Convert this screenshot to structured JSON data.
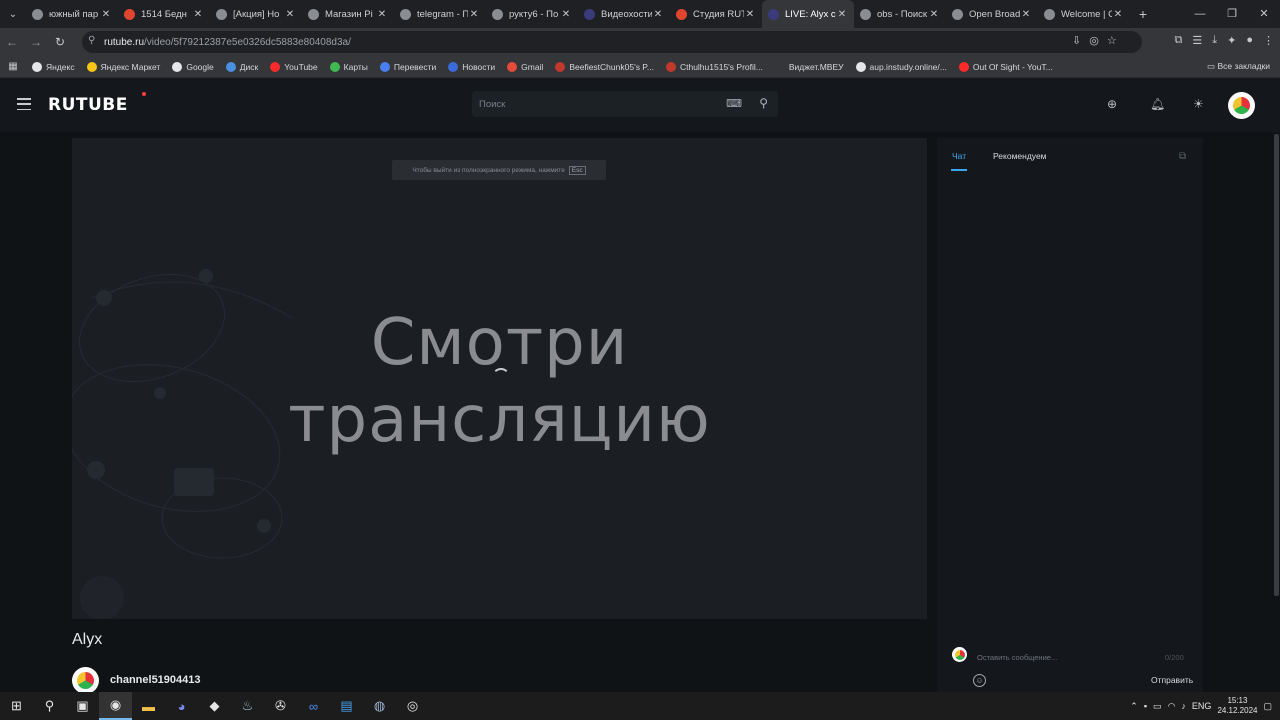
{
  "browser": {
    "tabs": [
      {
        "title": "южный пар",
        "color": "#8a8d91"
      },
      {
        "title": "1514 Бедн",
        "color": "#e0462f"
      },
      {
        "title": "[Акция] Но",
        "color": "#8a8d91"
      },
      {
        "title": "Магазин Pi",
        "color": "#8a8d91"
      },
      {
        "title": "telegram - П",
        "color": "#8a8d91"
      },
      {
        "title": "рукту6 - По",
        "color": "#8a8d91"
      },
      {
        "title": "Видеохости",
        "color": "#3b3a7a"
      },
      {
        "title": "Студия RUT",
        "color": "#e0462f"
      },
      {
        "title": "LIVE: Alyx c",
        "color": "#3b3a7a"
      },
      {
        "title": "obs - Поиск",
        "color": "#8a8d91"
      },
      {
        "title": "Open Broad",
        "color": "#8a8d91"
      },
      {
        "title": "Welcome | C",
        "color": "#8a8d91"
      }
    ],
    "active_tab_index": 8,
    "url_host": "rutube.ru",
    "url_path": "/video/5f79212387e5e0326dc5883e80408d3a/",
    "bookmarks": [
      {
        "label": "Яндекс",
        "color": "#e4e6e9"
      },
      {
        "label": "Яндекс Маркет",
        "color": "#f5c518"
      },
      {
        "label": "Google",
        "color": "#e4e6e9"
      },
      {
        "label": "Диск",
        "color": "#4a90e2"
      },
      {
        "label": "YouTube",
        "color": "#ff2a2a"
      },
      {
        "label": "Карты",
        "color": "#3fb950"
      },
      {
        "label": "Перевести",
        "color": "#4a7ff0"
      },
      {
        "label": "Новости",
        "color": "#3a6bd8"
      },
      {
        "label": "Gmail",
        "color": "#e44b3b"
      },
      {
        "label": "BeefiestChunk05's P...",
        "color": "#c0392b"
      },
      {
        "label": "Cthulhu1515's Profil...",
        "color": "#c0392b"
      },
      {
        "label": "Виджет.МВЕУ",
        "color": "#35363a"
      },
      {
        "label": "aup.instudy.online/...",
        "color": "#e4e6e9"
      },
      {
        "label": "Out Of Sight - YouT...",
        "color": "#ff2a2a"
      }
    ],
    "all_bookmarks": "Все закладки"
  },
  "header": {
    "logo": "RUTUBE",
    "search_placeholder": "Поиск"
  },
  "player": {
    "fullscreen_hint": "Чтобы выйти из полноэкранного режима, нажмите",
    "esc_key": "Esc",
    "overlay_line1": "Смотри",
    "overlay_line2": "трансляцию"
  },
  "video": {
    "title": "Alyx",
    "channel": "channel51904413"
  },
  "sidepanel": {
    "tab_chat": "Чат",
    "tab_recommended": "Рекомендуем",
    "message_placeholder": "Оставить сообщение...",
    "char_count": "0/200",
    "send": "Отправить"
  },
  "taskbar": {
    "lang": "ENG",
    "time": "15:13",
    "date": "24.12.2024"
  }
}
